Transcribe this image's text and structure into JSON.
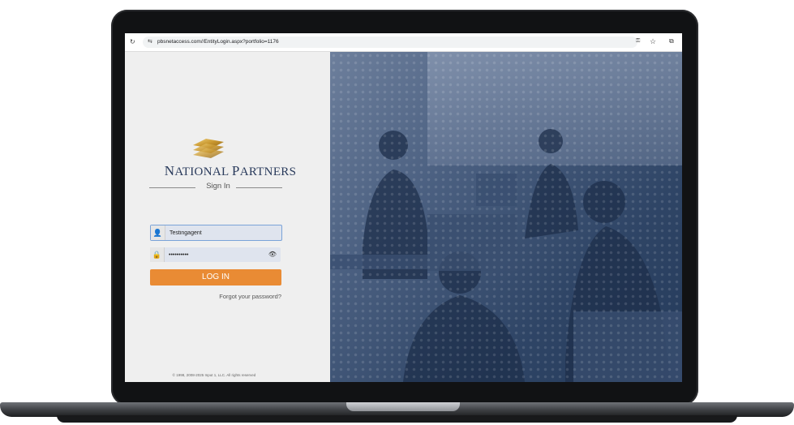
{
  "browser": {
    "url": "pbsnetaccess.com//EntityLogin.aspx?portfolio=1176",
    "reload_icon": "↻",
    "tune_icon": "⇆",
    "key_icon": "⚿",
    "star_icon": "☆",
    "extension_icon": "⧉"
  },
  "brand": {
    "name_first_initial": "N",
    "name_first_rest": "ATIONAL",
    "name_second_initial": "P",
    "name_second_rest": "ARTNERS"
  },
  "form": {
    "sign_in_label": "Sign In",
    "username_value": "Testingagent",
    "password_value": "••••••••••",
    "login_label": "LOG IN",
    "forgot_label": "Forgot your password?"
  },
  "footer": {
    "copyright": "© 1998, 2008-2025 Input 1, LLC. All rights reserved"
  },
  "colors": {
    "login_button": "#e98b34",
    "brand_text": "#2a3b5c",
    "photo_tint": "#2f4566"
  }
}
